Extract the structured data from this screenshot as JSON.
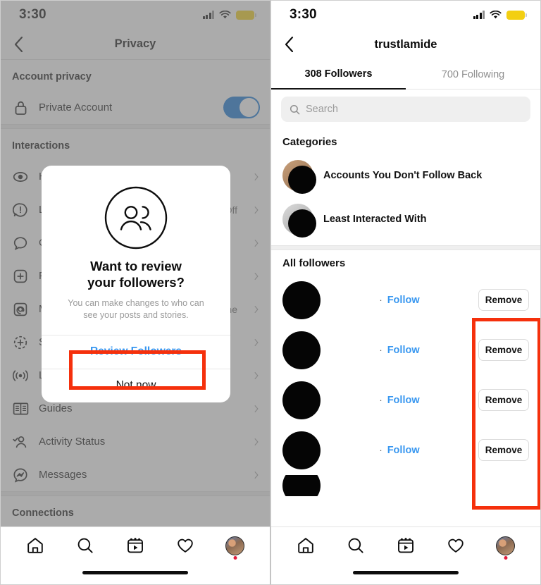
{
  "left_panel": {
    "status": {
      "time": "3:30",
      "signal_icon": "cellular-bars-icon",
      "wifi_icon": "wifi-icon",
      "battery_icon": "battery-low-power-icon"
    },
    "nav": {
      "back_icon": "back-chevron-icon",
      "title": "Privacy"
    },
    "sections": [
      {
        "heading": "Account privacy"
      },
      {
        "heading": "Interactions"
      },
      {
        "heading": "Connections"
      }
    ],
    "private_account": {
      "label": "Private Account",
      "icon": "lock-icon",
      "toggle_state": "on",
      "toggle_color": "#0b72d4"
    },
    "interaction_rows": [
      {
        "label": "Hidden Words",
        "icon": "hidden-words-icon",
        "value": ""
      },
      {
        "label": "Limits",
        "icon": "limits-icon",
        "value": "Off"
      },
      {
        "label": "Comments",
        "icon": "comment-icon",
        "value": ""
      },
      {
        "label": "Posts",
        "icon": "posts-plus-icon",
        "value": ""
      },
      {
        "label": "Mentions",
        "icon": "mention-at-icon",
        "value": "Everyone"
      },
      {
        "label": "Story",
        "icon": "story-plus-icon",
        "value": ""
      },
      {
        "label": "Live",
        "icon": "live-broadcast-icon",
        "value": ""
      },
      {
        "label": "Guides",
        "icon": "guides-book-icon",
        "value": ""
      },
      {
        "label": "Activity Status",
        "icon": "activity-status-icon",
        "value": ""
      },
      {
        "label": "Messages",
        "icon": "messenger-icon",
        "value": ""
      }
    ],
    "dialog": {
      "icon": "two-people-circle-icon",
      "title_line1": "Want to review",
      "title_line2": "your followers?",
      "subtitle": "You can make changes to who can see your posts and stories.",
      "primary_button": "Review Followers",
      "secondary_button": "Not now",
      "primary_color": "#3897f0"
    },
    "tabbar": [
      {
        "icon": "home-icon"
      },
      {
        "icon": "search-icon"
      },
      {
        "icon": "reels-icon"
      },
      {
        "icon": "heart-icon"
      },
      {
        "icon": "profile-avatar-icon"
      }
    ]
  },
  "right_panel": {
    "status": {
      "time": "3:30",
      "signal_icon": "cellular-bars-icon",
      "wifi_icon": "wifi-icon",
      "battery_icon": "battery-low-power-icon"
    },
    "nav": {
      "back_icon": "back-chevron-icon",
      "title": "trustlamide"
    },
    "tabs": [
      {
        "label": "308 Followers",
        "active": true
      },
      {
        "label": "700 Following",
        "active": false
      }
    ],
    "search": {
      "placeholder": "Search",
      "icon": "search-icon",
      "value": ""
    },
    "categories_heading": "Categories",
    "categories": [
      {
        "label": "Accounts You Don't Follow Back",
        "avatar": "redacted-avatar"
      },
      {
        "label": "Least Interacted With",
        "avatar": "redacted-avatar"
      }
    ],
    "all_followers_heading": "All followers",
    "followers": [
      {
        "avatar": "redacted-avatar",
        "bullet": "·",
        "follow_label": "Follow",
        "remove_label": "Remove"
      },
      {
        "avatar": "redacted-avatar",
        "bullet": "·",
        "follow_label": "Follow",
        "remove_label": "Remove"
      },
      {
        "avatar": "redacted-avatar",
        "bullet": "·",
        "follow_label": "Follow",
        "remove_label": "Remove"
      },
      {
        "avatar": "redacted-avatar",
        "bullet": "·",
        "follow_label": "Follow",
        "remove_label": "Remove"
      }
    ],
    "tabbar": [
      {
        "icon": "home-icon"
      },
      {
        "icon": "search-icon"
      },
      {
        "icon": "reels-icon"
      },
      {
        "icon": "heart-icon"
      },
      {
        "icon": "profile-avatar-icon"
      }
    ]
  },
  "annotations": {
    "highlight_color": "#f5300c",
    "boxes": [
      {
        "name": "review-followers-highlight"
      },
      {
        "name": "remove-buttons-highlight"
      }
    ]
  }
}
